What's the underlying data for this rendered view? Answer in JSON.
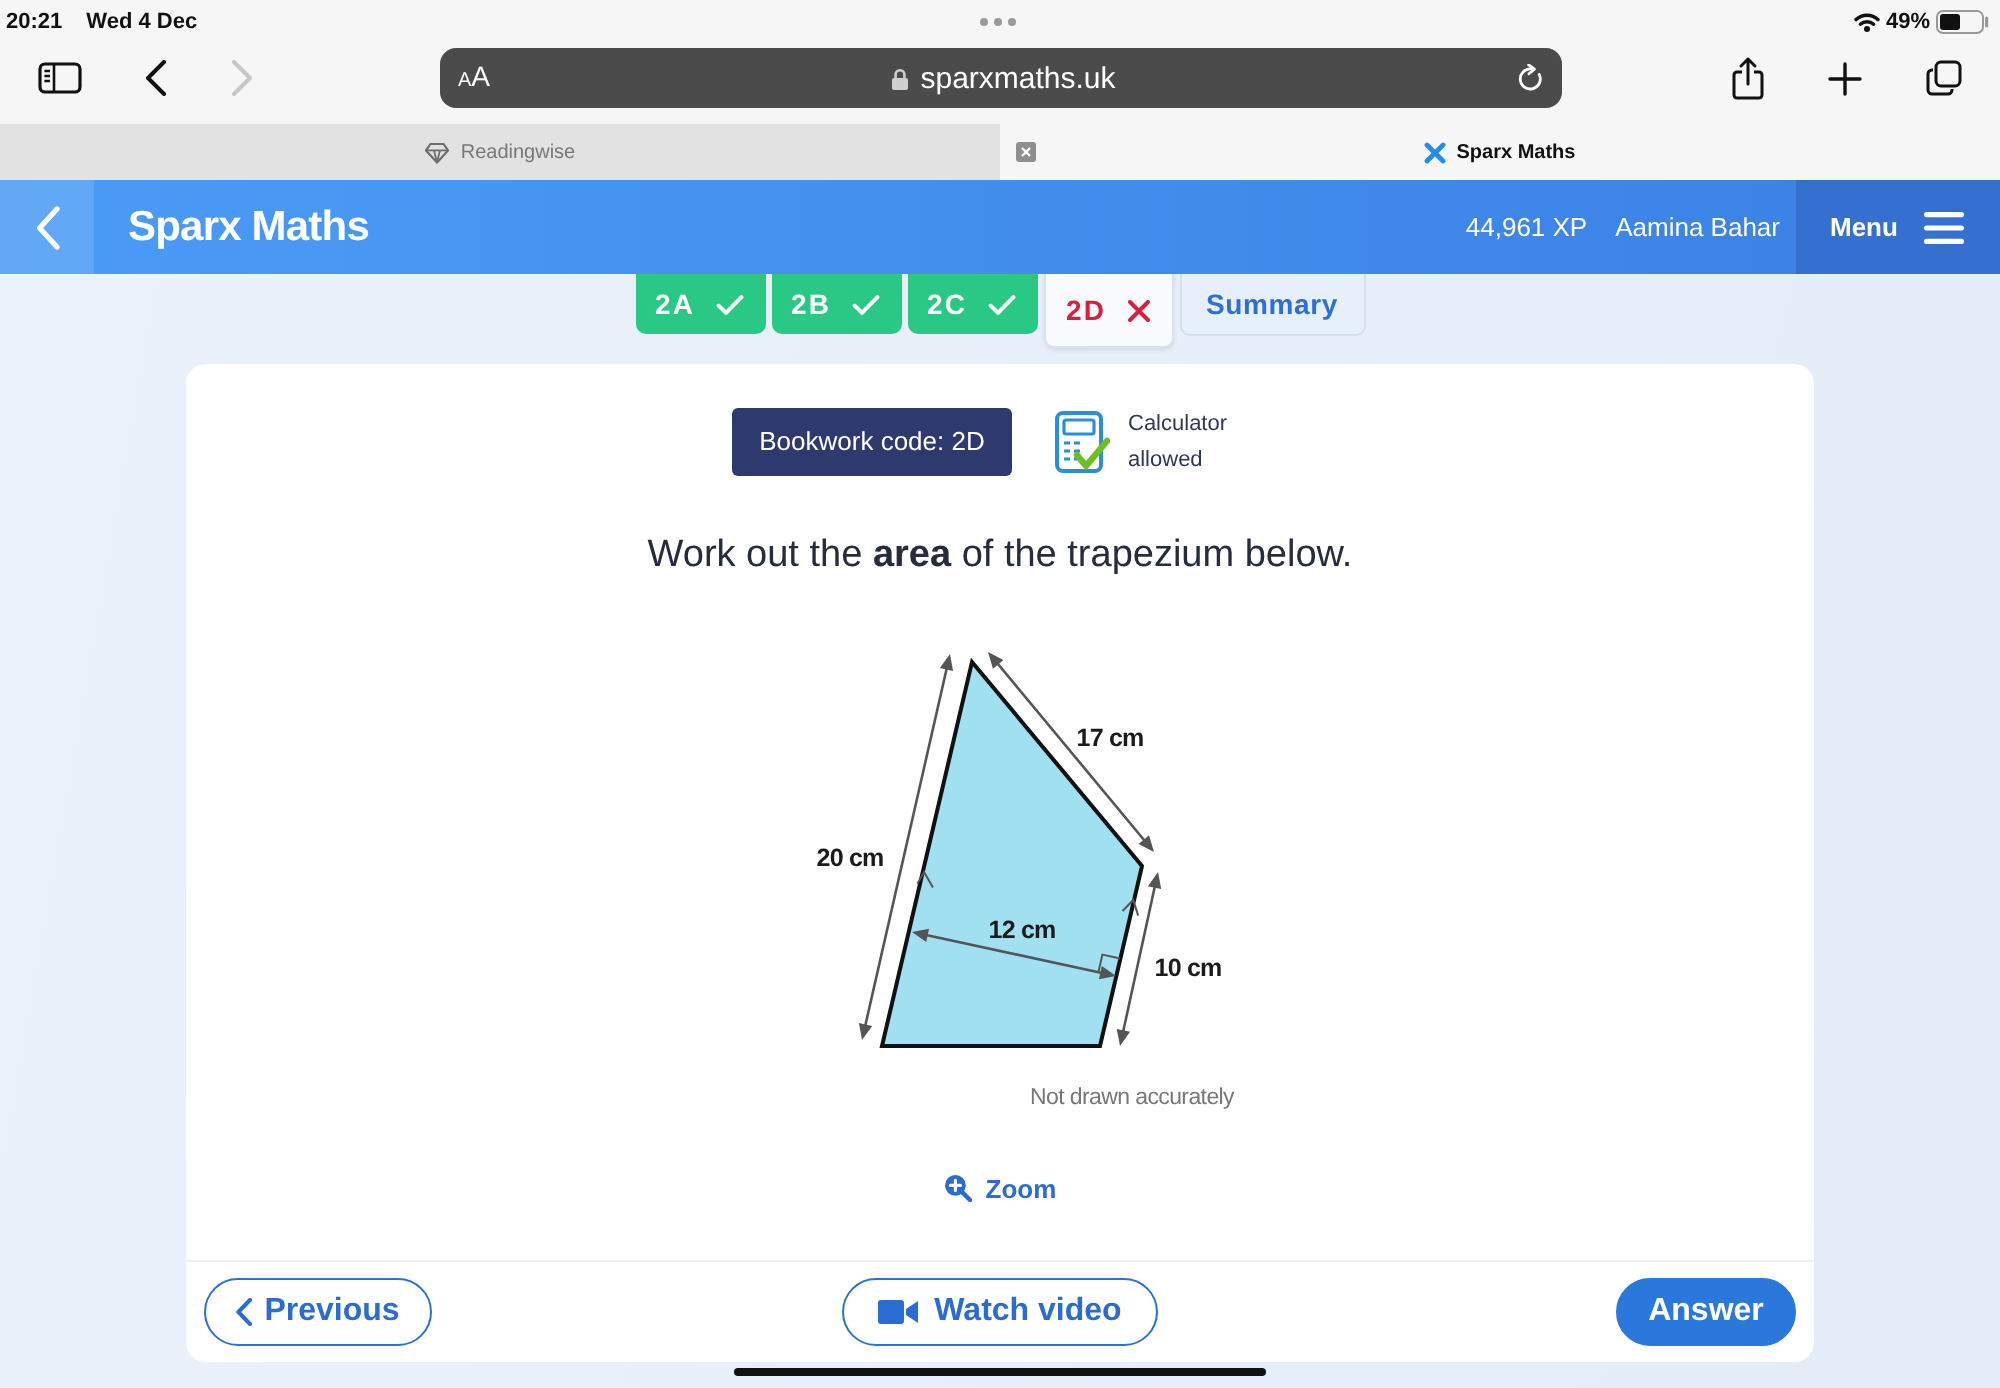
{
  "status_bar": {
    "time": "20:21",
    "date": "Wed 4 Dec",
    "battery": "49%"
  },
  "browser": {
    "back_disabled": false,
    "forward_disabled": true,
    "text_size": "AA",
    "address": "sparxmaths.uk",
    "tabs": [
      {
        "title": "Readingwise",
        "selected": false
      },
      {
        "title": "Sparx Maths",
        "selected": true
      }
    ]
  },
  "app_bar": {
    "title": "Sparx Maths",
    "xp": "44,961 XP",
    "user": "Aamina Bahar",
    "menu": "Menu"
  },
  "task_tabs": [
    {
      "label": "2A",
      "kind": "correct",
      "selected": false
    },
    {
      "label": "2B",
      "kind": "correct",
      "selected": false
    },
    {
      "label": "2C",
      "kind": "correct",
      "selected": false
    },
    {
      "label": "2D",
      "kind": "incorrect",
      "selected": true
    },
    {
      "label": "Summary",
      "kind": "summary",
      "selected": false
    }
  ],
  "question": {
    "bookwork_code": "Bookwork code: 2D",
    "calculator": "Calculator allowed",
    "text": "Work out the **area** of the trapezium below.",
    "diagram": {
      "labels": [
        "17 cm",
        "20 cm",
        "12 cm",
        "10 cm"
      ],
      "note": "Not drawn accurately"
    },
    "zoom": "Zoom"
  },
  "footer": {
    "previous": "Previous",
    "watch_video": "Watch video",
    "answer": "Answer"
  }
}
